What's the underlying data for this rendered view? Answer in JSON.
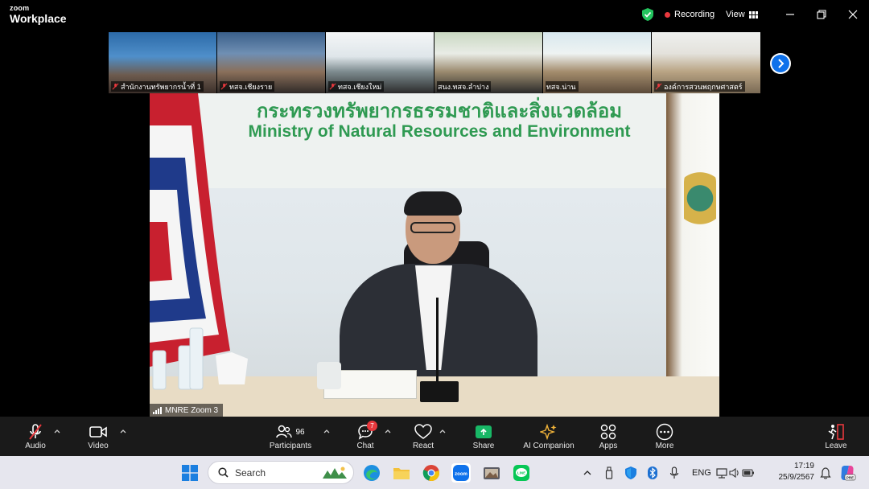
{
  "app": {
    "logo_top": "zoom",
    "logo_bottom": "Workplace",
    "recording_label": "Recording",
    "view_label": "View"
  },
  "thumbnails": [
    {
      "name": "สำนักงานทรัพยากรน้ำที่ 1",
      "muted": true
    },
    {
      "name": "ทสจ.เชียงราย",
      "muted": true
    },
    {
      "name": "ทสจ.เชียงใหม่",
      "muted": true
    },
    {
      "name": "สนง.ทสจ.ลำปาง",
      "muted": false
    },
    {
      "name": "ทสจ.น่าน",
      "muted": false
    },
    {
      "name": "องค์การสวนพฤกษศาสตร์",
      "muted": true
    }
  ],
  "main_video": {
    "participant_label": "MNRE Zoom 3",
    "wall_text_thai": "กระทรวงทรัพยากรธรรมชาติและสิ่งแวดล้อม",
    "wall_text_english": "Ministry of Natural Resources and Environment"
  },
  "toolbar": {
    "audio": "Audio",
    "video": "Video",
    "participants": "Participants",
    "participants_count": "96",
    "chat": "Chat",
    "chat_badge": "7",
    "react": "React",
    "share": "Share",
    "ai_companion": "AI Companion",
    "apps": "Apps",
    "more": "More",
    "leave": "Leave"
  },
  "taskbar": {
    "search_placeholder": "Search",
    "language": "ENG",
    "time": "17:19",
    "date": "25/9/2567"
  },
  "colors": {
    "zoom_blue": "#0e71eb",
    "recording_red": "#e8383d",
    "share_green": "#18b866",
    "ministry_green": "#2f9a52",
    "toolbar_bg": "#1a1a1a",
    "taskbar_bg": "#e6e6ee"
  }
}
